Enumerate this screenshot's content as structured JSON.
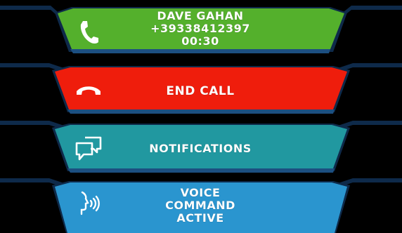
{
  "call": {
    "caller_name": "DAVE GAHAN",
    "caller_number": "+39338412397",
    "duration": "00:30",
    "icon": "phone-icon",
    "color": "#54b02c"
  },
  "end_call": {
    "label": "END CALL",
    "icon": "hang-up-icon",
    "color": "#ef1d0c"
  },
  "notifications": {
    "label": "NOTIFICATIONS",
    "icon": "chat-bubbles-icon",
    "color": "#2198a0"
  },
  "voice_command": {
    "line1": "VOICE",
    "line2": "COMMAND",
    "line3": "ACTIVE",
    "icon": "voice-command-icon",
    "color": "#2a95cf"
  },
  "frame_color": "#0e2a4a"
}
